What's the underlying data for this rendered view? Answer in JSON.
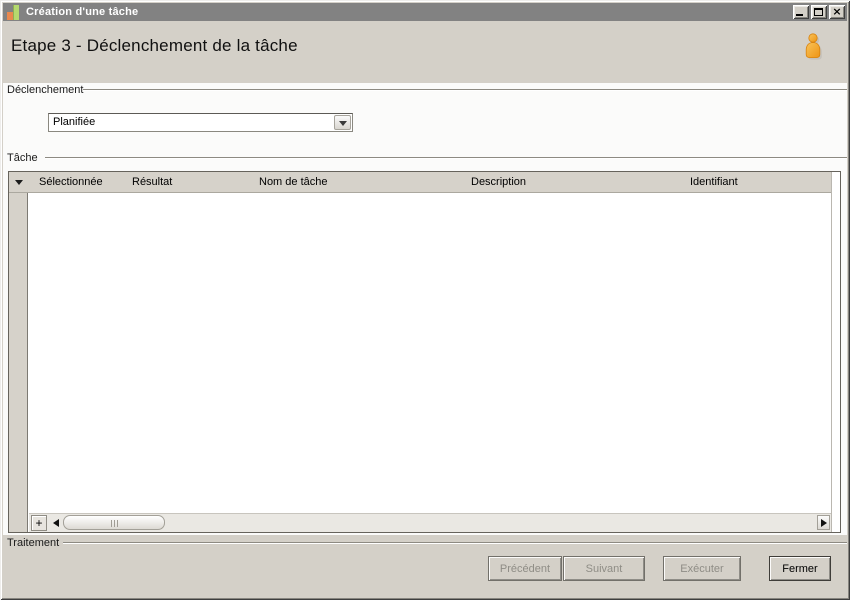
{
  "titlebar": {
    "title": "Création d'une tâche"
  },
  "header": {
    "title": "Etape 3 - Déclenchement de la tâche"
  },
  "trigger_group": {
    "label": "Déclenchement",
    "combo_value": "Planifiée"
  },
  "task_group": {
    "label": "Tâche",
    "columns": [
      "Sélectionnée",
      "Résultat",
      "Nom de tâche",
      "Description",
      "Identifiant"
    ],
    "rows": [],
    "add_button": "+"
  },
  "footer": {
    "label": "Traitement",
    "buttons": [
      {
        "label": "Précédent",
        "enabled": false
      },
      {
        "label": "Suivant",
        "enabled": false
      },
      {
        "label": "Exécuter",
        "enabled": false
      },
      {
        "label": "Fermer",
        "enabled": true
      }
    ]
  },
  "colors": {
    "chrome": "#d4d0c8",
    "titlebar": "#828282",
    "content_bg": "#fbfbfa",
    "grid_header_bg": "#d6d2ca",
    "person_icon_orange": "#f0a42c",
    "app_icon_orange": "#e9884e",
    "app_icon_green": "#b5d96e",
    "disabled_text": "#8f8d86"
  }
}
